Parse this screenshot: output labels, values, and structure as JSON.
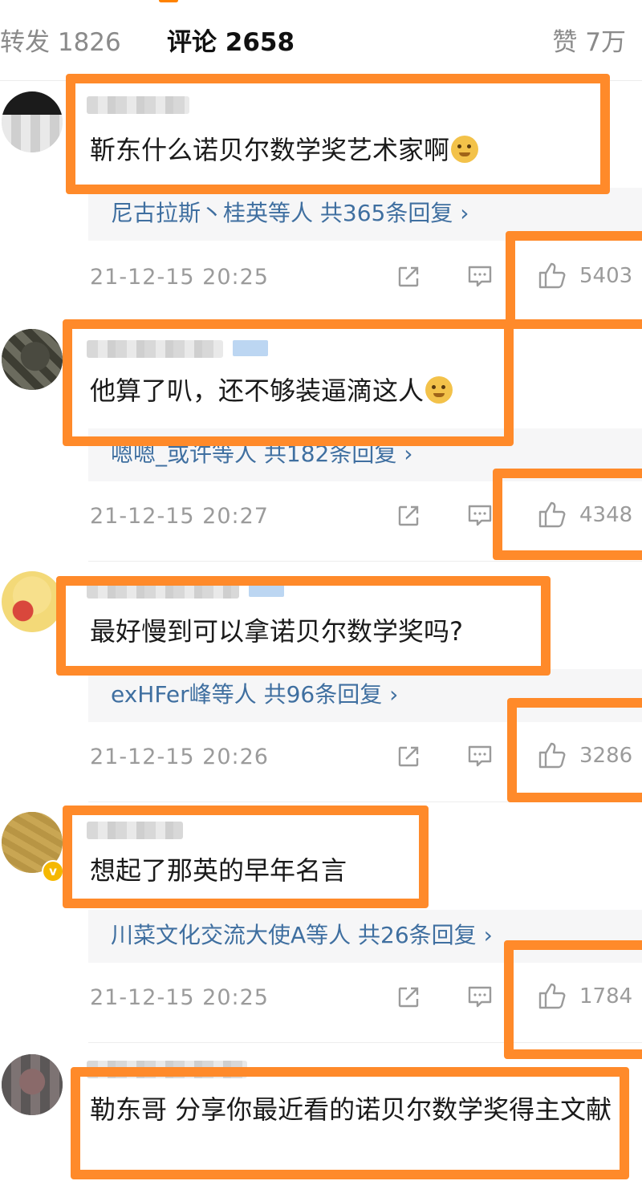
{
  "tabs": {
    "repost": "转发 1826",
    "comments": "评论 2658",
    "likes": "赞 7万"
  },
  "colors": {
    "highlight": "#ff8a2a",
    "link": "#3f6fa0",
    "accent": "#ff8200",
    "meta": "#9b9b9b"
  },
  "icons": {
    "share": "share-icon",
    "comment": "comment-icon",
    "like": "thumbs-up-icon",
    "verified": "verified-badge-icon"
  },
  "comments": [
    {
      "text": "靳东什么诺贝尔数学奖艺术家啊",
      "emoji": "doge-emoji",
      "replies": "尼古拉斯丶桂英等人  共365条回复 ›",
      "time": "21-12-15 20:25",
      "likes": "5403"
    },
    {
      "text": "他算了叭，还不够装逼滴这人",
      "emoji": "thinking-emoji",
      "replies": "嗯嗯_或许等人  共182条回复 ›",
      "time": "21-12-15 20:27",
      "likes": "4348"
    },
    {
      "text": "最好慢到可以拿诺贝尔数学奖吗?",
      "replies": "exHFer峰等人  共96条回复 ›",
      "time": "21-12-15 20:26",
      "likes": "3286"
    },
    {
      "text": "想起了那英的早年名言",
      "replies": "川菜文化交流大使A等人  共26条回复 ›",
      "time": "21-12-15 20:25",
      "likes": "1784"
    },
    {
      "text": "勒东哥 分享你最近看的诺贝尔数学奖得主文献"
    }
  ]
}
